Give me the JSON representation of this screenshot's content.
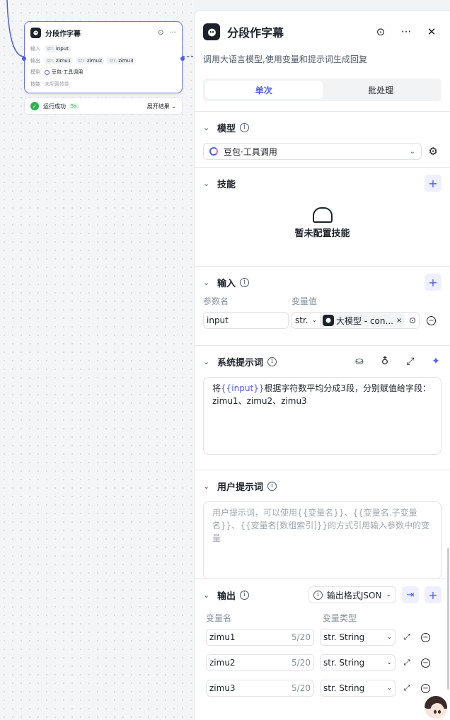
{
  "node": {
    "title": "分段作字幕",
    "input_label": "输入",
    "input_type": "str.",
    "input_value": "input",
    "output_label": "输出",
    "outputs": [
      {
        "type": "str.",
        "name": "zimu1"
      },
      {
        "type": "str.",
        "name": "zimu2"
      },
      {
        "type": "str.",
        "name": "zimu3"
      }
    ],
    "model_label": "模型",
    "model_value": "豆包·工具调用",
    "skill_label": "技能",
    "skill_value": "未配置技能",
    "run_status": "运行成功",
    "run_time": "5s",
    "expand_result": "展开结果 ⌄"
  },
  "panel": {
    "title": "分段作字幕",
    "description": "调用大语言模型,使用变量和提示词生成回复",
    "tabs": [
      "单次",
      "批处理"
    ],
    "active_tab": 0,
    "model_section": {
      "title": "模型",
      "selected": "豆包·工具调用"
    },
    "skills_section": {
      "title": "技能",
      "empty_text": "暂未配置技能"
    },
    "input_section": {
      "title": "输入",
      "col_name": "参数名",
      "col_value": "变量值",
      "param_name": "input",
      "type": "str.",
      "ref_text": "大模型 - con..."
    },
    "system_prompt": {
      "title": "系统提示词",
      "text_before": "将",
      "variable": "{{input}}",
      "text_after": "根据字符数平均分成3段，分别赋值给字段：zimu1、zimu2、zimu3"
    },
    "user_prompt": {
      "title": "用户提示词",
      "placeholder": "用户提示词，可以使用{{变量名}}、{{变量名.子变量名}}、{{变量名[数组索引]}}的方式引用输入参数中的变量"
    },
    "output_section": {
      "title": "输出",
      "format": "输出格式JSON",
      "col_name": "变量名",
      "col_type": "变量类型",
      "rows": [
        {
          "name": "zimu1",
          "count": "5/20",
          "type": "str. String"
        },
        {
          "name": "zimu2",
          "count": "5/20",
          "type": "str. String"
        },
        {
          "name": "zimu3",
          "count": "5/20",
          "type": "str. String"
        }
      ]
    }
  },
  "colors": {
    "accent": "#4e5cf0",
    "success": "#2bb24c",
    "text": "#1d2129"
  }
}
